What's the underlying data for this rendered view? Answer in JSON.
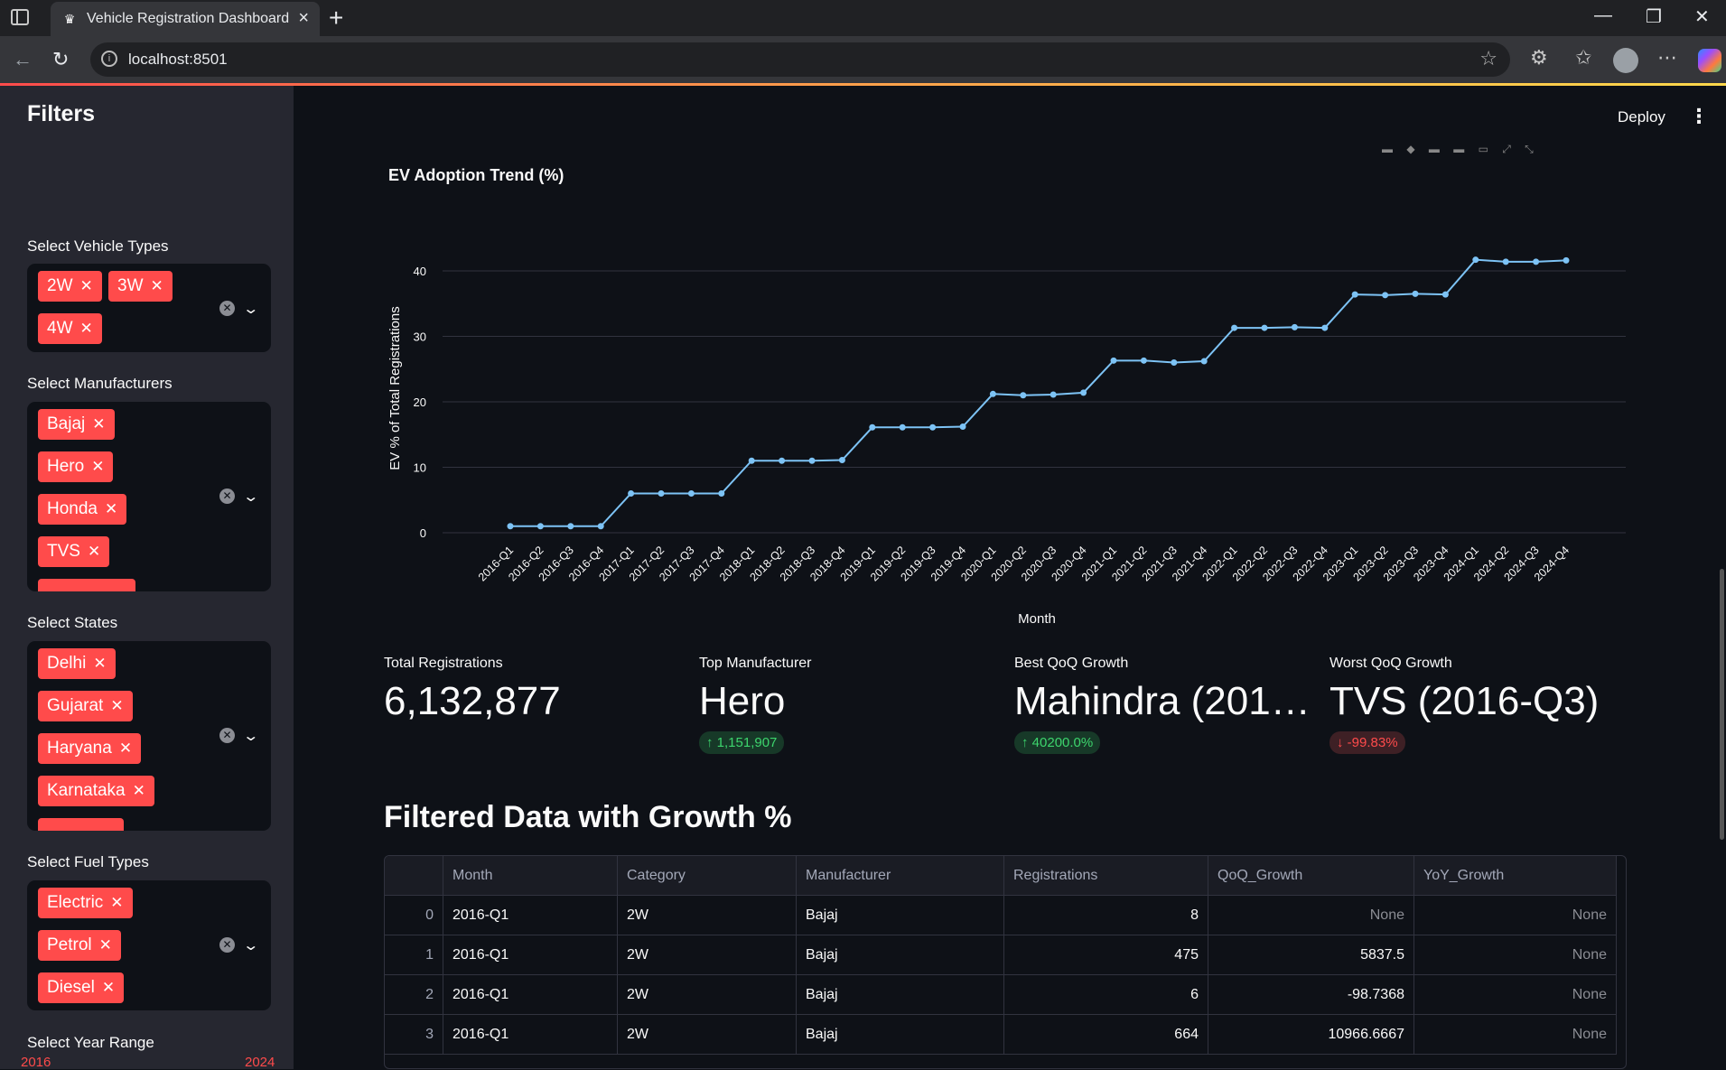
{
  "browser": {
    "tab_title": "Vehicle Registration Dashboard",
    "url": "localhost:8501"
  },
  "app": {
    "deploy_label": "Deploy"
  },
  "sidebar": {
    "title": "Filters",
    "vehicle_types": {
      "label": "Select Vehicle Types",
      "chips": [
        "2W",
        "3W",
        "4W"
      ]
    },
    "manufacturers": {
      "label": "Select Manufacturers",
      "chips": [
        "Bajaj",
        "Hero",
        "Honda",
        "TVS"
      ]
    },
    "states": {
      "label": "Select States",
      "chips": [
        "Delhi",
        "Gujarat",
        "Haryana",
        "Karnataka"
      ]
    },
    "fuel_types": {
      "label": "Select Fuel Types",
      "chips": [
        "Electric",
        "Petrol",
        "Diesel"
      ]
    },
    "year_range": {
      "label": "Select Year Range",
      "min": "2016",
      "max": "2024"
    }
  },
  "chart_data": {
    "type": "line",
    "title": "EV Adoption Trend (%)",
    "xlabel": "Month",
    "ylabel": "EV % of Total Registrations",
    "ylim": [
      0,
      45
    ],
    "yticks": [
      0,
      10,
      20,
      30,
      40
    ],
    "grid": true,
    "color": "#7dc3f5",
    "x": [
      "2016-Q1",
      "2016-Q2",
      "2016-Q3",
      "2016-Q4",
      "2017-Q1",
      "2017-Q2",
      "2017-Q3",
      "2017-Q4",
      "2018-Q1",
      "2018-Q2",
      "2018-Q3",
      "2018-Q4",
      "2019-Q1",
      "2019-Q2",
      "2019-Q3",
      "2019-Q4",
      "2020-Q1",
      "2020-Q2",
      "2020-Q3",
      "2020-Q4",
      "2021-Q1",
      "2021-Q2",
      "2021-Q3",
      "2021-Q4",
      "2022-Q1",
      "2022-Q2",
      "2022-Q3",
      "2022-Q4",
      "2023-Q1",
      "2023-Q2",
      "2023-Q3",
      "2023-Q4",
      "2024-Q1",
      "2024-Q2",
      "2024-Q3",
      "2024-Q4"
    ],
    "y": [
      1,
      1,
      1,
      1,
      6,
      6,
      6,
      6,
      11,
      11,
      11,
      11.1,
      16.1,
      16.1,
      16.1,
      16.2,
      21.2,
      21,
      21.1,
      21.4,
      26.3,
      26.3,
      26,
      26.2,
      31.3,
      31.3,
      31.4,
      31.3,
      36.4,
      36.3,
      36.5,
      36.4,
      41.7,
      41.4,
      41.4,
      41.6
    ]
  },
  "metrics": [
    {
      "label": "Total Registrations",
      "value": "6,132,877",
      "delta": "",
      "direction": ""
    },
    {
      "label": "Top Manufacturer",
      "value": "Hero",
      "delta": "1,151,907",
      "direction": "up"
    },
    {
      "label": "Best QoQ Growth",
      "value": "Mahindra (201…",
      "delta": "40200.0%",
      "direction": "up"
    },
    {
      "label": "Worst QoQ Growth",
      "value": "TVS (2016-Q3)",
      "delta": "-99.83%",
      "direction": "down"
    }
  ],
  "table": {
    "title": "Filtered Data with Growth %",
    "columns": [
      "",
      "Month",
      "Category",
      "Manufacturer",
      "Registrations",
      "QoQ_Growth",
      "YoY_Growth"
    ],
    "rows": [
      [
        "0",
        "2016-Q1",
        "2W",
        "Bajaj",
        "8",
        "None",
        "None"
      ],
      [
        "1",
        "2016-Q1",
        "2W",
        "Bajaj",
        "475",
        "5837.5",
        "None"
      ],
      [
        "2",
        "2016-Q1",
        "2W",
        "Bajaj",
        "6",
        "-98.7368",
        "None"
      ],
      [
        "3",
        "2016-Q1",
        "2W",
        "Bajaj",
        "664",
        "10966.6667",
        "None"
      ]
    ]
  }
}
